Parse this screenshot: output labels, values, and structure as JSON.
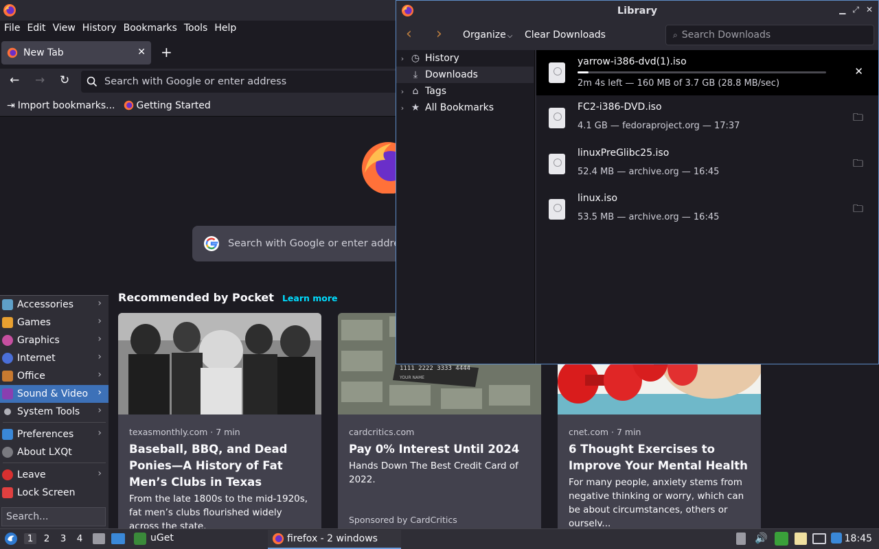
{
  "browser": {
    "menu": [
      "File",
      "Edit",
      "View",
      "History",
      "Bookmarks",
      "Tools",
      "Help"
    ],
    "tab": {
      "label": "New Tab"
    },
    "url_placeholder": "Search with Google or enter address",
    "bookmarks": [
      "Import bookmarks...",
      "Getting Started"
    ]
  },
  "newtab": {
    "search_placeholder": "Search with Google or enter address",
    "pocket_heading": "Recommended by Pocket",
    "learn_more": "Learn more",
    "cards": [
      {
        "source": "texasmonthly.com · 7 min",
        "title": "Baseball, BBQ, and Dead Ponies—A History of Fat Men’s Clubs in Texas",
        "excerpt": "From the late 1800s to the mid-1920s, fat men’s clubs flourished widely across the state."
      },
      {
        "source": "cardcritics.com",
        "title": "Pay 0% Interest Until 2024",
        "excerpt": "Hands Down The Best Credit Card of 2022.",
        "sponsor": "Sponsored by CardCritics",
        "card_number": "1111 2222 3333 4444",
        "card_name": "YOUR NAME"
      },
      {
        "source": "cnet.com · 7 min",
        "title": "6 Thought Exercises to Improve Your Mental Health",
        "excerpt": "For many people, anxiety stems from negative thinking or worry, which can be about circumstances, others or ourselv..."
      }
    ]
  },
  "app_menu": {
    "items": [
      "Accessories",
      "Games",
      "Graphics",
      "Internet",
      "Office",
      "Sound & Video",
      "System Tools",
      "Preferences",
      "About LXQt",
      "Leave",
      "Lock Screen"
    ],
    "active": "Sound & Video",
    "search_placeholder": "Search..."
  },
  "library": {
    "title": "Library",
    "organize": "Organize",
    "clear": "Clear Downloads",
    "search_placeholder": "Search Downloads",
    "sidebar": [
      "History",
      "Downloads",
      "Tags",
      "All Bookmarks"
    ],
    "downloads": [
      {
        "name": "yarrow-i386-dvd(1).iso",
        "status": "2m 4s left — 160 MB of 3.7 GB (28.8 MB/sec)",
        "progress": 0.043
      },
      {
        "name": "FC2-i386-DVD.iso",
        "status": "4.1 GB — fedoraproject.org — 17:37"
      },
      {
        "name": "linuxPreGlibc25.iso",
        "status": "52.4 MB — archive.org — 16:45"
      },
      {
        "name": "linux.iso",
        "status": "53.5 MB — archive.org — 16:45"
      }
    ]
  },
  "taskbar": {
    "workspaces": [
      "1",
      "2",
      "3",
      "4"
    ],
    "apps": [
      "uGet"
    ],
    "firefox_label": "firefox - 2 windows",
    "clock": "18:45"
  },
  "colors": {
    "accent": "#00ddff",
    "menu_highlight": "#3d71b8"
  }
}
